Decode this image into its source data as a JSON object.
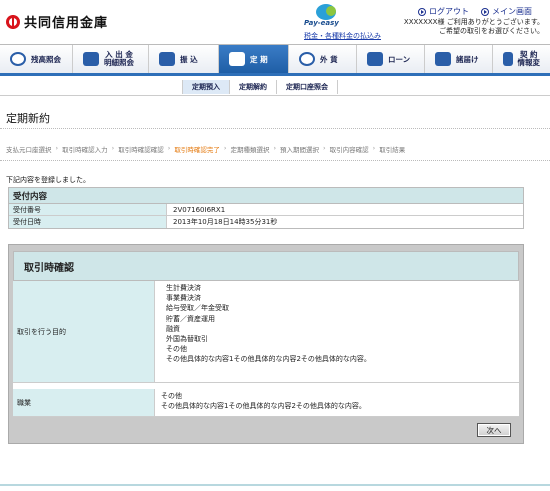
{
  "header": {
    "bank_name": "共同信用金庫",
    "payeasy_name": "Pay-easy",
    "payeasy_link": "税金・各種料金の払込み",
    "logout_label": "ログアウト",
    "main_label": "メイン画面",
    "greeting_line1": "XXXXXXX様 ご利用ありがとうございます。",
    "greeting_line2": "ご希望の取引をお選びください。"
  },
  "nav": {
    "items": [
      {
        "label": "残高照会"
      },
      {
        "label1": "入 出 金",
        "label2": "明細照会"
      },
      {
        "label": "振 込"
      },
      {
        "label": "定 期"
      },
      {
        "label": "外 貨"
      },
      {
        "label": "ローン"
      },
      {
        "label": "諸届け"
      },
      {
        "label1": "契 約",
        "label2": "情報変"
      }
    ]
  },
  "subnav": {
    "items": [
      "定期預入",
      "定期解約",
      "定期口座照会"
    ]
  },
  "page_title": "定期新約",
  "steps": [
    "支払元口座選択",
    "取引時確認入力",
    "取引時確認確認",
    "取引時確認完了",
    "定期種類選択",
    "預入期間選択",
    "取引内容確認",
    "取引結果"
  ],
  "current_step": "取引時確認完了",
  "message": "下記内容を登録しました。",
  "receipt": {
    "title": "受付内容",
    "rows": [
      {
        "label": "受付番号",
        "value": "2V07160I6RX1"
      },
      {
        "label": "受付日時",
        "value": "2013年10月18日14時35分31秒"
      }
    ]
  },
  "confirm": {
    "title": "取引時確認",
    "purpose_label": "取引を行う目的",
    "purpose_values": [
      "生計費決済",
      "事業費決済",
      "給与受取／年金受取",
      "貯蓄／資産運用",
      "融資",
      "外国為替取引",
      "その他",
      "その他具体的な内容1その他具体的な内容2その他具体的な内容。"
    ],
    "occupation_label": "職業",
    "occupation_values": [
      "その他",
      "その他具体的な内容1その他具体的な内容2その他具体的な内容。"
    ],
    "next_button": "次へ"
  }
}
